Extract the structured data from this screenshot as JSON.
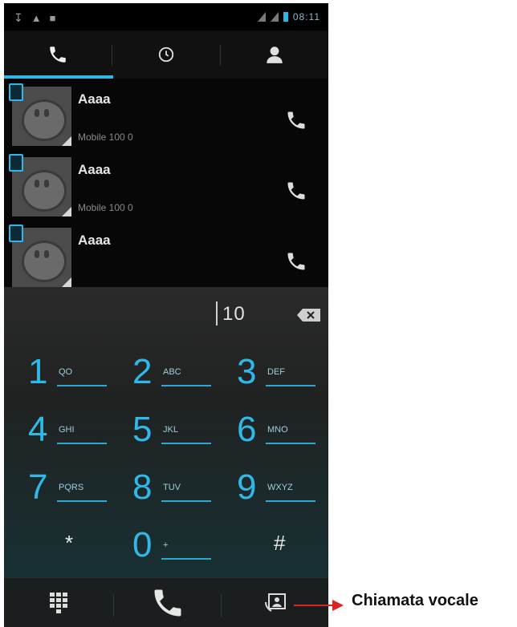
{
  "status_bar": {
    "left_icons": [
      "usb-icon",
      "warning-icon",
      "android-icon"
    ],
    "right_icons": [
      "signal-icon",
      "signal-icon",
      "battery-icon"
    ],
    "clock": "08:11"
  },
  "tabs": [
    {
      "name": "phone",
      "icon": "phone-icon",
      "active": true
    },
    {
      "name": "recents",
      "icon": "clock-icon",
      "active": false
    },
    {
      "name": "contacts",
      "icon": "person-icon",
      "active": false
    }
  ],
  "contacts": [
    {
      "name": "Aaaa",
      "number": "Mobile 100 0"
    },
    {
      "name": "Aaaa",
      "number": "Mobile 100 0"
    },
    {
      "name": "Aaaa",
      "number": ""
    }
  ],
  "dialer": {
    "entered_number": "10",
    "keys": [
      {
        "digit": "1",
        "letters": "QO"
      },
      {
        "digit": "2",
        "letters": "ABC"
      },
      {
        "digit": "3",
        "letters": "DEF"
      },
      {
        "digit": "4",
        "letters": "GHI"
      },
      {
        "digit": "5",
        "letters": "JKL"
      },
      {
        "digit": "6",
        "letters": "MNO"
      },
      {
        "digit": "7",
        "letters": "PQRS"
      },
      {
        "digit": "8",
        "letters": "TUV"
      },
      {
        "digit": "9",
        "letters": "WXYZ"
      },
      {
        "digit": "*",
        "letters": ""
      },
      {
        "digit": "0",
        "letters": "+"
      },
      {
        "digit": "#",
        "letters": ""
      }
    ]
  },
  "bottom_bar": [
    "keypad-icon",
    "call-icon",
    "video-call-icon"
  ],
  "annotation": "Chiamata vocale",
  "colors": {
    "accent": "#2fb7e7",
    "background": "#000000"
  }
}
